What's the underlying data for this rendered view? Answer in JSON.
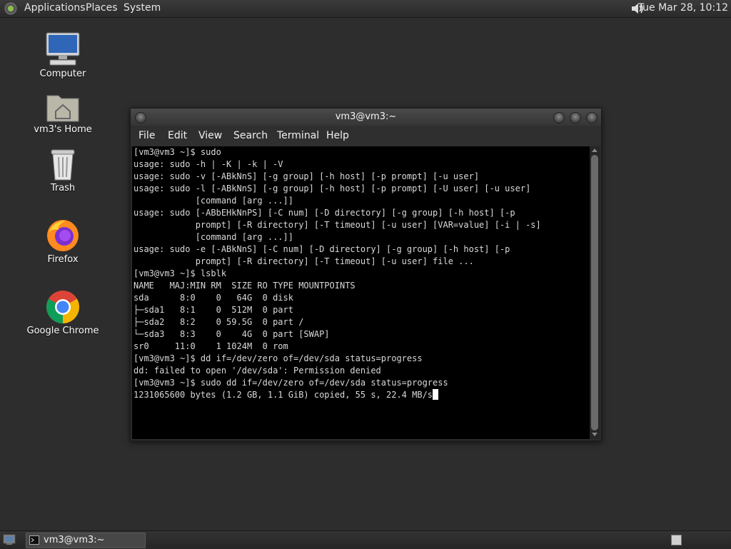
{
  "top_panel": {
    "menus": [
      "Applications",
      "Places",
      "System"
    ],
    "clock": "Tue Mar 28, 10:12"
  },
  "desktop": {
    "icons": [
      {
        "label": "Computer",
        "icon": "computer-icon"
      },
      {
        "label": "vm3's Home",
        "icon": "home-folder-icon"
      },
      {
        "label": "Trash",
        "icon": "trash-icon"
      },
      {
        "label": "Firefox",
        "icon": "firefox-icon"
      },
      {
        "label": "Google Chrome",
        "icon": "chrome-icon"
      }
    ]
  },
  "terminal": {
    "title": "vm3@vm3:~",
    "menu": [
      "File",
      "Edit",
      "View",
      "Search",
      "Terminal",
      "Help"
    ],
    "lines": [
      "[vm3@vm3 ~]$ sudo",
      "usage: sudo -h | -K | -k | -V",
      "usage: sudo -v [-ABkNnS] [-g group] [-h host] [-p prompt] [-u user]",
      "usage: sudo -l [-ABkNnS] [-g group] [-h host] [-p prompt] [-U user] [-u user]",
      "            [command [arg ...]]",
      "usage: sudo [-ABbEHkNnPS] [-C num] [-D directory] [-g group] [-h host] [-p",
      "            prompt] [-R directory] [-T timeout] [-u user] [VAR=value] [-i | -s]",
      "            [command [arg ...]]",
      "usage: sudo -e [-ABkNnS] [-C num] [-D directory] [-g group] [-h host] [-p",
      "            prompt] [-R directory] [-T timeout] [-u user] file ...",
      "[vm3@vm3 ~]$ lsblk",
      "NAME   MAJ:MIN RM  SIZE RO TYPE MOUNTPOINTS",
      "sda      8:0    0   64G  0 disk",
      "├─sda1   8:1    0  512M  0 part",
      "├─sda2   8:2    0 59.5G  0 part /",
      "└─sda3   8:3    0    4G  0 part [SWAP]",
      "sr0     11:0    1 1024M  0 rom",
      "[vm3@vm3 ~]$ dd if=/dev/zero of=/dev/sda status=progress",
      "dd: failed to open '/dev/sda': Permission denied",
      "[vm3@vm3 ~]$ sudo dd if=/dev/zero of=/dev/sda status=progress",
      "1231065600 bytes (1.2 GB, 1.1 GiB) copied, 55 s, 22.4 MB/s"
    ]
  },
  "taskbar": {
    "window_button": "vm3@vm3:~"
  }
}
